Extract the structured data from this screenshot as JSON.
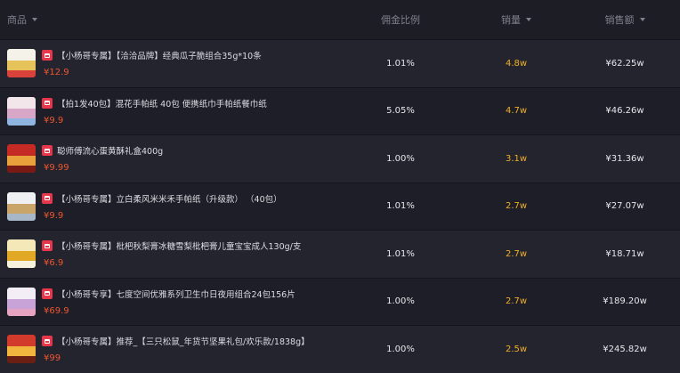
{
  "header": {
    "product": "商品",
    "commission": "佣金比例",
    "sales": "销量",
    "amount": "销售额"
  },
  "colors": {
    "price": "#f0552f",
    "sales": "#f2b024",
    "tag": "#e8364b"
  },
  "rows": [
    {
      "title": "【小杨哥专属】【洽洽品牌】经典瓜子脆组合35g*10条",
      "price": "¥12.9",
      "commission": "1.01%",
      "sales": "4.8w",
      "amount": "¥62.25w",
      "thumb_colors": [
        "#f5f2ea",
        "#e6c25a",
        "#d9423b"
      ]
    },
    {
      "title": "【拍1发40包】混花手帕纸 40包 便携纸巾手帕纸餐巾纸",
      "price": "¥9.9",
      "commission": "5.05%",
      "sales": "4.7w",
      "amount": "¥46.26w",
      "thumb_colors": [
        "#f3e6ea",
        "#d8a6c6",
        "#8fb4e0"
      ]
    },
    {
      "title": "聪师傅流心蛋黄酥礼盒400g",
      "price": "¥9.99",
      "commission": "1.00%",
      "sales": "3.1w",
      "amount": "¥31.36w",
      "thumb_colors": [
        "#c52a24",
        "#e9a13b",
        "#7a1a14"
      ]
    },
    {
      "title": "【小杨哥专属】立白柔风米米禾手帕纸（升级款） （40包）",
      "price": "¥9.9",
      "commission": "1.01%",
      "sales": "2.7w",
      "amount": "¥27.07w",
      "thumb_colors": [
        "#eef0f2",
        "#c9a56a",
        "#a8b7c8"
      ]
    },
    {
      "title": "【小杨哥专属】枇杷秋梨膏冰糖雪梨枇杷膏儿童宝宝成人130g/支",
      "price": "¥6.9",
      "commission": "1.01%",
      "sales": "2.7w",
      "amount": "¥18.71w",
      "thumb_colors": [
        "#f4e7b8",
        "#e0a825",
        "#f7f2de"
      ]
    },
    {
      "title": "【小杨哥专享】七度空间优雅系列卫生巾日夜用组合24包156片",
      "price": "¥69.9",
      "commission": "1.00%",
      "sales": "2.7w",
      "amount": "¥189.20w",
      "thumb_colors": [
        "#f3eef6",
        "#c7a3d8",
        "#e6a4c1"
      ]
    },
    {
      "title": "【小杨哥专属】推荐_【三只松鼠_年货节坚果礼包/欢乐款/1838g】",
      "price": "¥99",
      "commission": "1.00%",
      "sales": "2.5w",
      "amount": "¥245.82w",
      "thumb_colors": [
        "#d23a2c",
        "#f2b63e",
        "#6b1e12"
      ]
    }
  ]
}
